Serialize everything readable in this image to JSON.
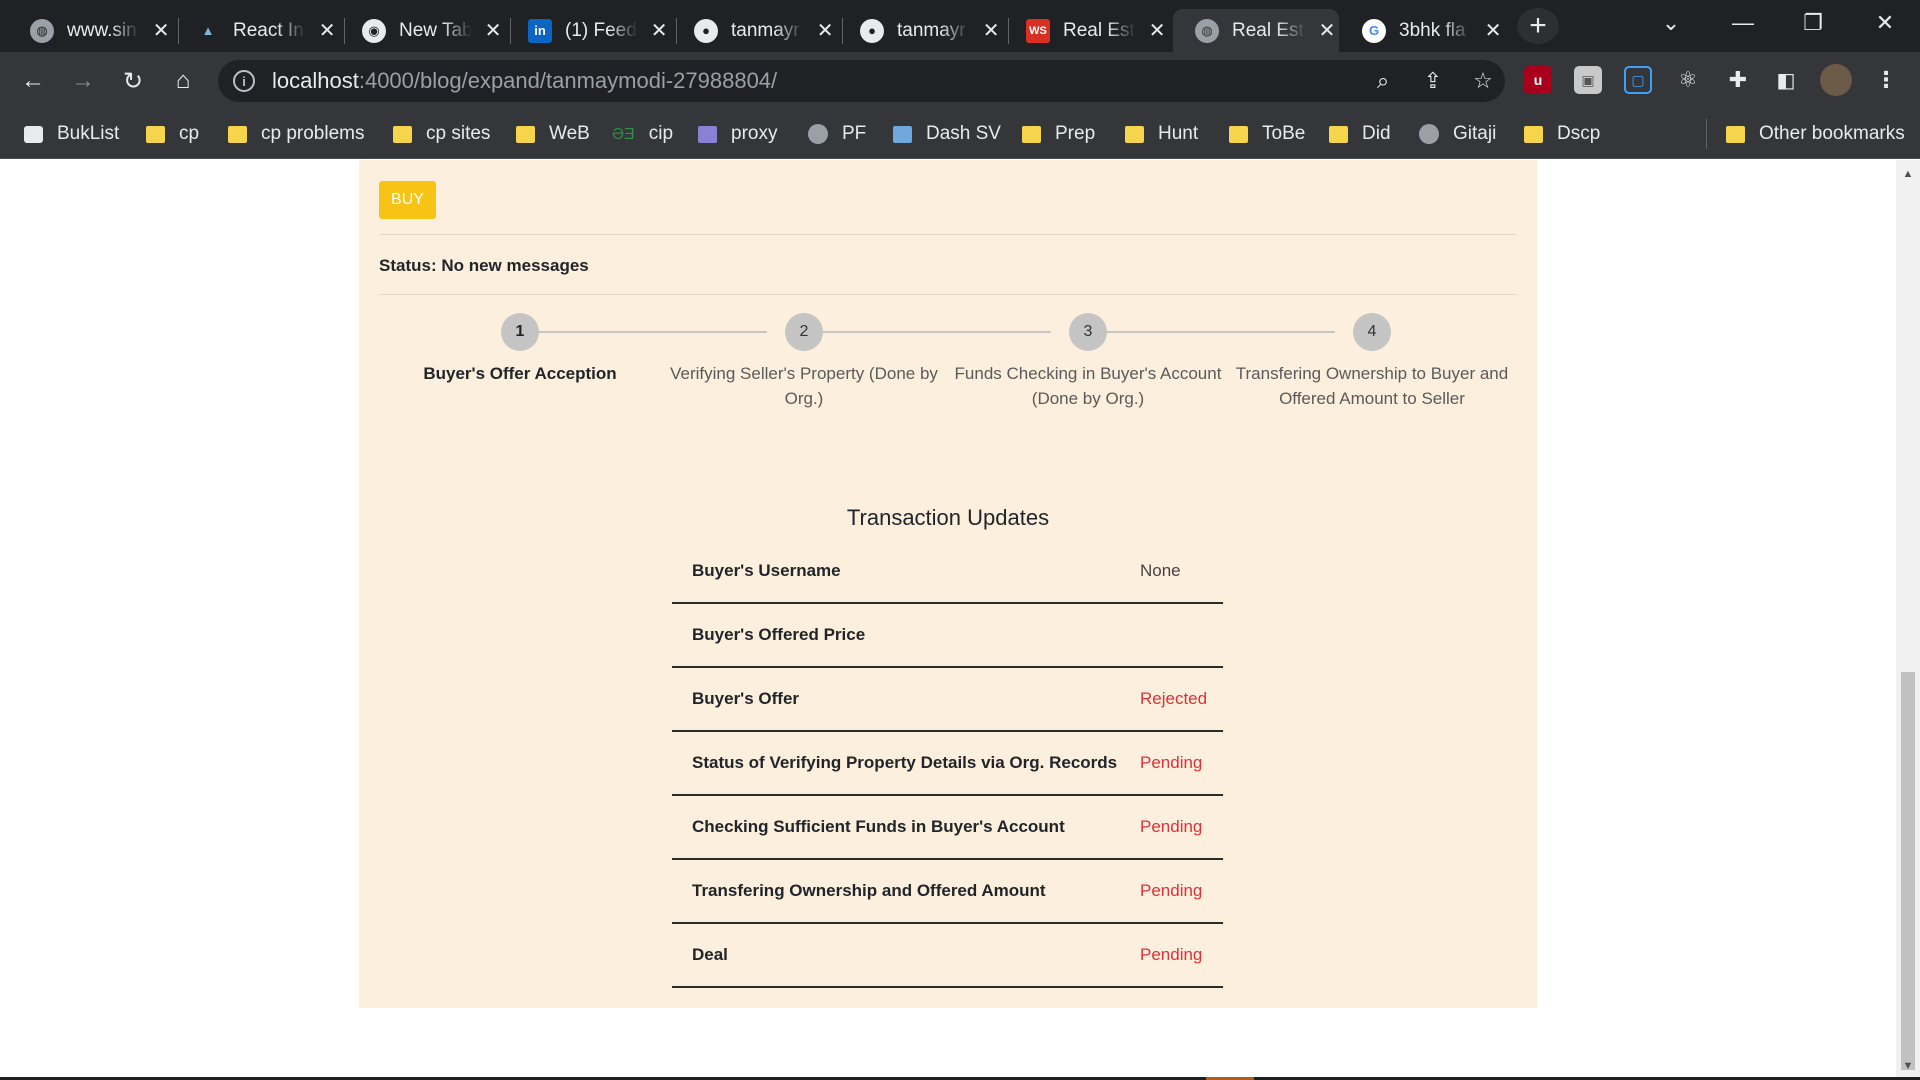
{
  "browser": {
    "tabs": [
      {
        "title": "www.sin",
        "icon": "globe-icon"
      },
      {
        "title": "React In",
        "icon": "mountain-icon"
      },
      {
        "title": "New Tab",
        "icon": "chrome-icon"
      },
      {
        "title": "(1) Feed",
        "icon": "linkedin-icon"
      },
      {
        "title": "tanmayr",
        "icon": "github-icon"
      },
      {
        "title": "tanmayr",
        "icon": "github-icon"
      },
      {
        "title": "Real Est",
        "icon": "ws-icon"
      },
      {
        "title": "Real Est",
        "icon": "globe-icon"
      },
      {
        "title": "3bhk fla",
        "icon": "google-icon"
      }
    ],
    "address": {
      "host": "localhost",
      "path": ":4000/blog/expand/tanmaymodi-27988804/"
    },
    "bookmarks": [
      {
        "label": "BukList",
        "icon": "buklist-icon"
      },
      {
        "label": "cp",
        "icon": "folder-icon"
      },
      {
        "label": "cp problems",
        "icon": "folder-icon"
      },
      {
        "label": "cp sites",
        "icon": "folder-icon"
      },
      {
        "label": "WeB",
        "icon": "folder-icon"
      },
      {
        "label": "cip",
        "icon": "gfg-icon"
      },
      {
        "label": "proxy",
        "icon": "proxy-icon"
      },
      {
        "label": "PF",
        "icon": "globe-icon"
      },
      {
        "label": "Dash SV",
        "icon": "chart-icon"
      },
      {
        "label": "Prep",
        "icon": "folder-icon"
      },
      {
        "label": "Hunt",
        "icon": "folder-icon"
      },
      {
        "label": "ToBe",
        "icon": "folder-icon"
      },
      {
        "label": "Did",
        "icon": "folder-icon"
      },
      {
        "label": "Gitaji",
        "icon": "globe-icon"
      },
      {
        "label": "Dscp",
        "icon": "folder-icon"
      }
    ],
    "other_bookmarks": "Other bookmarks",
    "colors": {
      "frame": "#202124",
      "toolbar": "#35363a",
      "folder": "#f6d44b"
    }
  },
  "page": {
    "buy_label": "BUY",
    "status_text": "Status: No new messages",
    "steps": [
      {
        "num": "1",
        "label": "Buyer's Offer Acception"
      },
      {
        "num": "2",
        "label": "Verifying Seller's Property (Done by Org.)"
      },
      {
        "num": "3",
        "label": "Funds Checking in Buyer's Account (Done by Org.)"
      },
      {
        "num": "4",
        "label": "Transfering Ownership to Buyer and Offered Amount to Seller"
      }
    ],
    "transactions": {
      "title": "Transaction Updates",
      "rows": [
        {
          "key": "Buyer's Username",
          "value": "None",
          "tone": "neutral"
        },
        {
          "key": "Buyer's Offered Price",
          "value": "",
          "tone": "neutral"
        },
        {
          "key": "Buyer's Offer",
          "value": "Rejected",
          "tone": "bad"
        },
        {
          "key": "Status of Verifying Property Details via Org. Records",
          "value": "Pending",
          "tone": "bad"
        },
        {
          "key": "Checking Sufficient Funds in Buyer's Account",
          "value": "Pending",
          "tone": "bad"
        },
        {
          "key": "Transfering Ownership and Offered Amount",
          "value": "Pending",
          "tone": "bad"
        },
        {
          "key": "Deal",
          "value": "Pending",
          "tone": "bad"
        }
      ]
    },
    "colors": {
      "card_bg": "#fdefdd",
      "buy_button": "#f7c314",
      "pending_text": "#e0303a"
    }
  }
}
